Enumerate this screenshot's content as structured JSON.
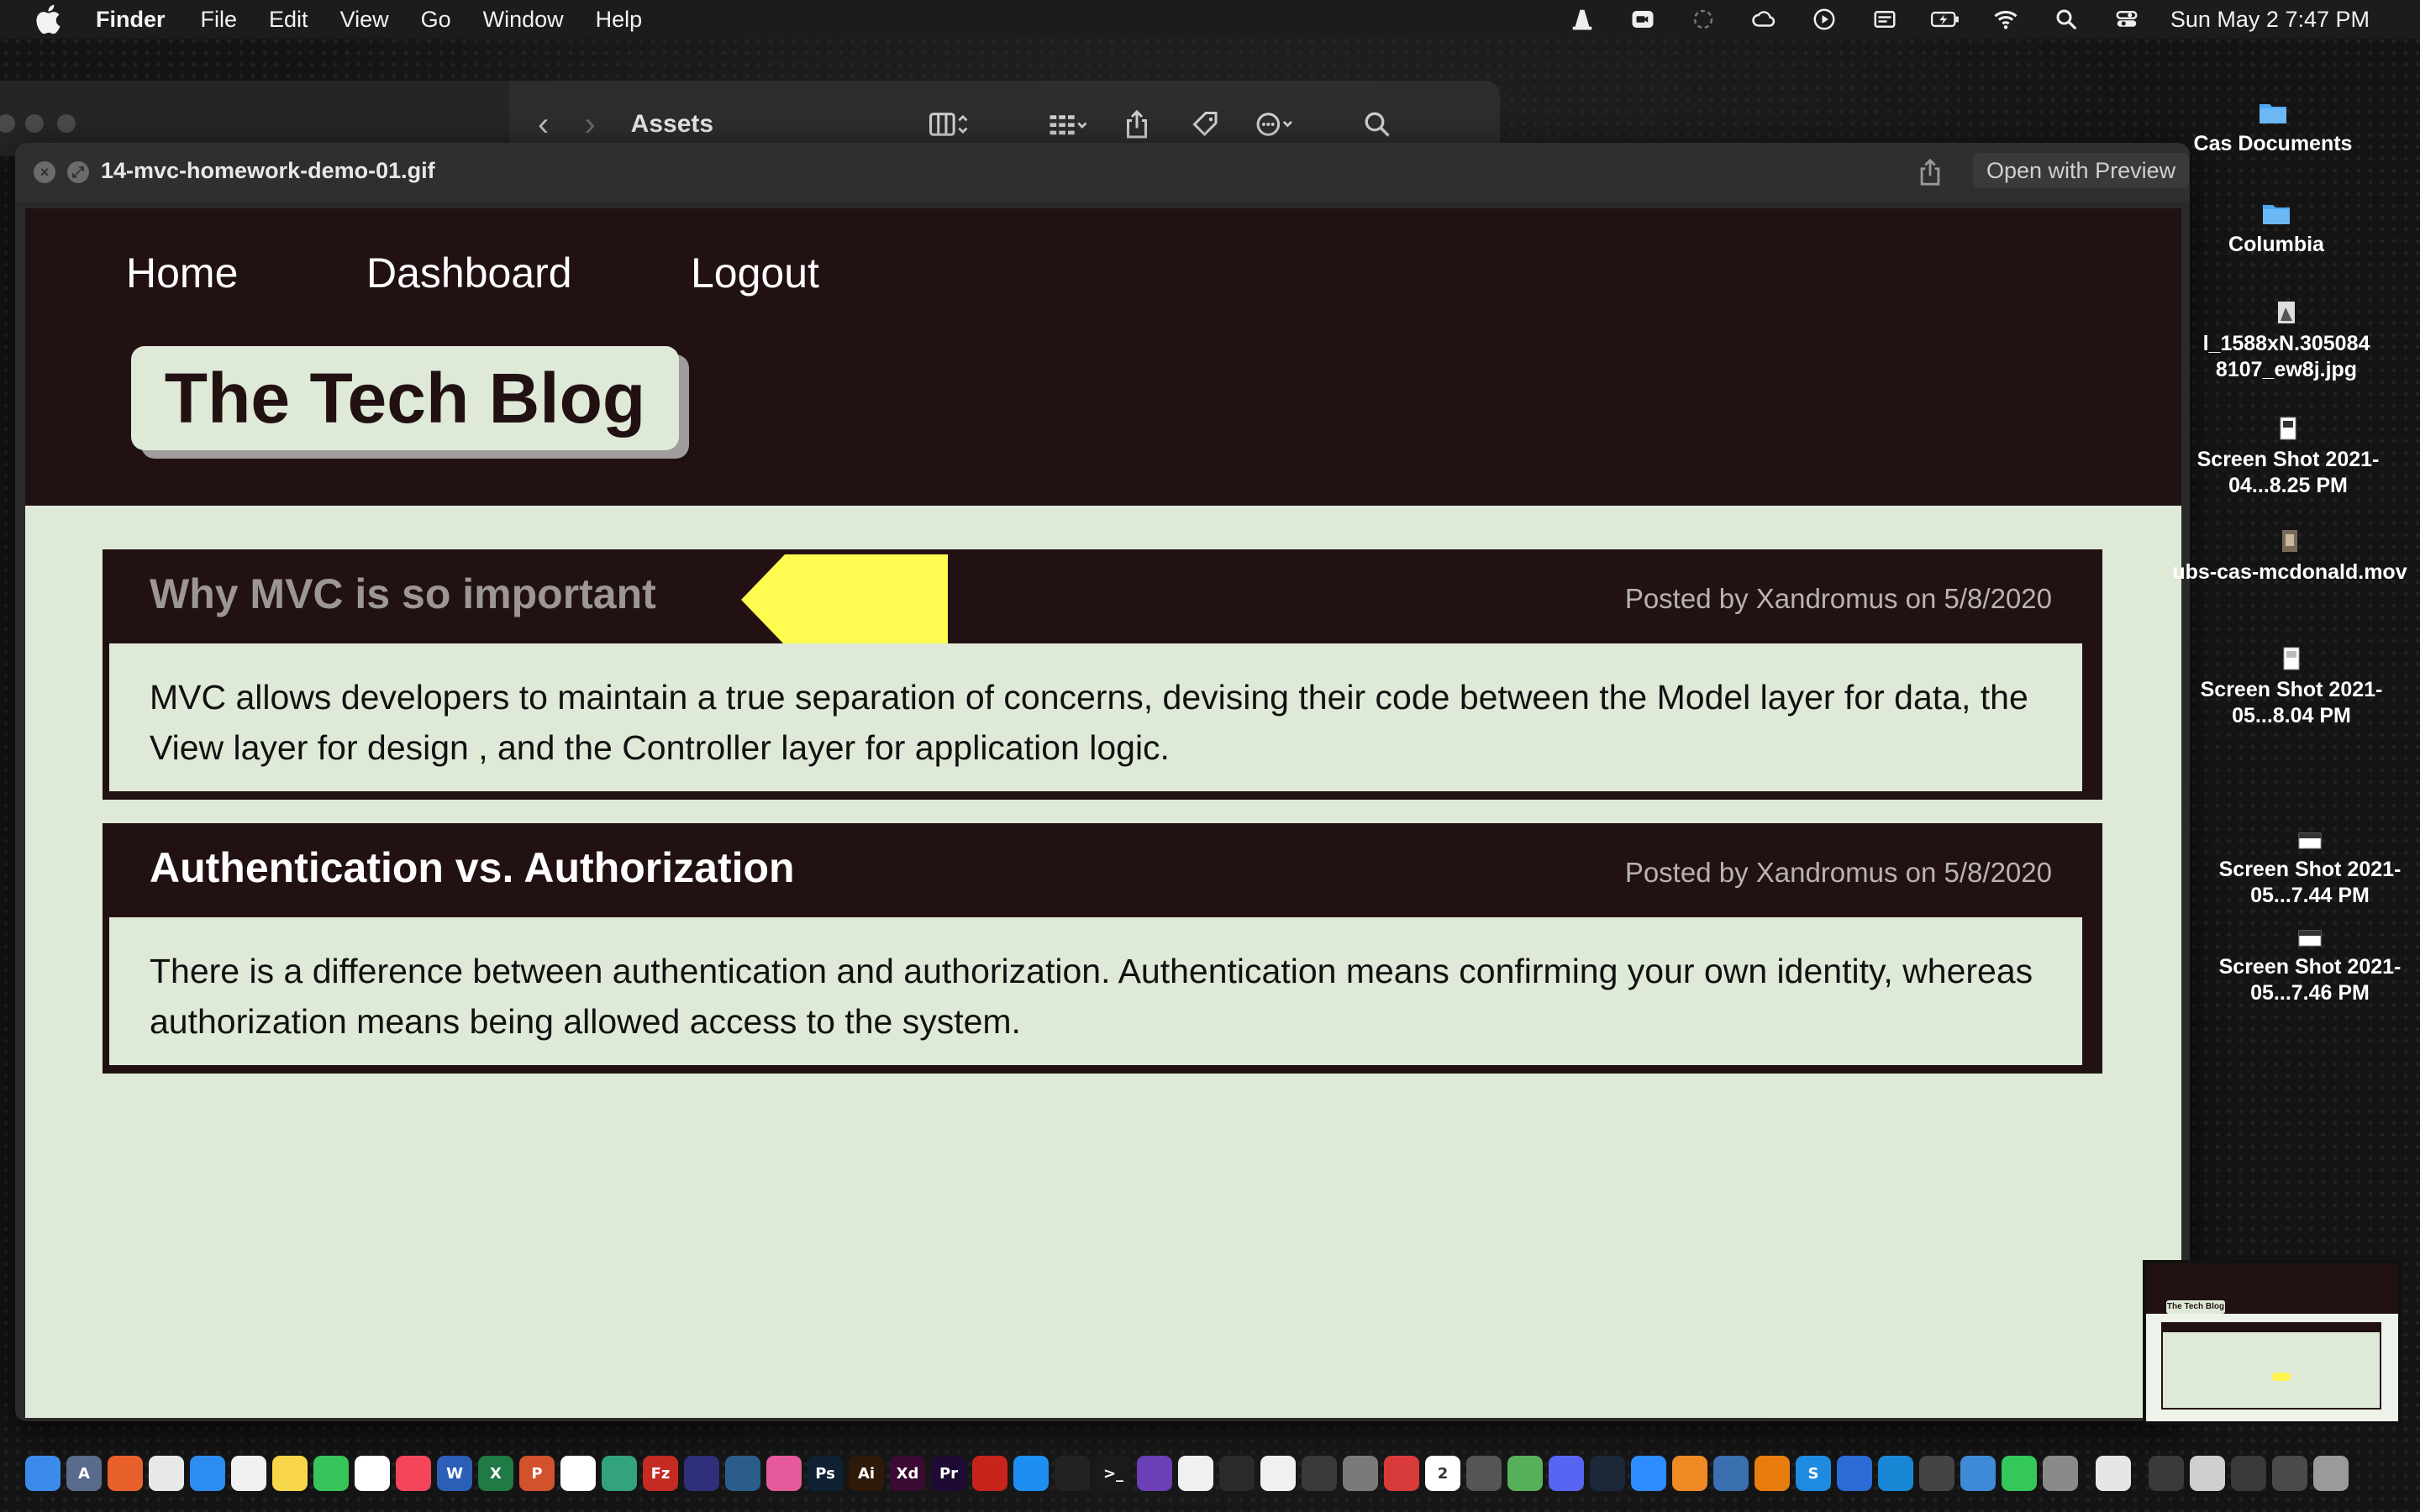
{
  "menubar": {
    "app_name": "Finder",
    "items": [
      "File",
      "Edit",
      "View",
      "Go",
      "Window",
      "Help"
    ],
    "status_icons": [
      "vlc-cone-icon",
      "zoom-video-icon",
      "creative-cloud-sync-icon",
      "creative-cloud-icon",
      "play-circle-icon",
      "keyboard-input-icon",
      "battery-charging-icon",
      "wifi-icon",
      "spotlight-search-icon",
      "control-center-icon"
    ],
    "datetime": "Sun May 2  7:47 PM"
  },
  "finder": {
    "title": "Assets",
    "back_icon": "chevron-left-icon",
    "forward_icon": "chevron-right-icon"
  },
  "quicklook": {
    "filename": "14-mvc-homework-demo-01.gif",
    "open_with": "Open with Preview"
  },
  "blog": {
    "nav": [
      "Home",
      "Dashboard",
      "Logout"
    ],
    "brand": "The Tech Blog",
    "posts": [
      {
        "title": "Why MVC is so important",
        "meta": "Posted by Xandromus on 5/8/2020",
        "body": "MVC allows developers to maintain a true separation of concerns, devising their code between the Model layer for data, the View layer for design , and the Controller layer for application logic."
      },
      {
        "title": "Authentication vs. Authorization",
        "meta": "Posted by Xandromus on 5/8/2020",
        "body": "There is a difference between authentication and authorization. Authentication means confirming your own identity, whereas authorization means being allowed access to the system."
      }
    ]
  },
  "desktop": {
    "items": [
      {
        "label": "Cas Documents",
        "icon": "folder-icon"
      },
      {
        "label": "Columbia",
        "icon": "folder-icon"
      },
      {
        "label": "l_1588xN.305084 8107_ew8j.jpg",
        "icon": "image-file-icon"
      },
      {
        "label": "Screen Shot 2021-04...8.25 PM",
        "icon": "screenshot-file-icon"
      },
      {
        "label": "ubs-cas-mcdonald.mov",
        "icon": "video-file-icon"
      },
      {
        "label": "Screen Shot 2021-05...8.04 PM",
        "icon": "screenshot-file-icon"
      },
      {
        "label": "Screen Shot 2021-05...7.44 PM",
        "icon": "screenshot-file-icon"
      },
      {
        "label": "Screen Shot 2021-05...7.46 PM",
        "icon": "screenshot-file-icon"
      }
    ],
    "thumbnail_brand": "The Tech Blog"
  },
  "dock": {
    "apps": [
      {
        "name": "finder",
        "color": "#3b8beb",
        "glyph": ""
      },
      {
        "name": "launchpad",
        "color": "#5a6b8c",
        "glyph": "A"
      },
      {
        "name": "firefox",
        "color": "#e8612c",
        "glyph": ""
      },
      {
        "name": "chrome",
        "color": "#e8e8e8",
        "glyph": ""
      },
      {
        "name": "safari",
        "color": "#2d8cf0",
        "glyph": ""
      },
      {
        "name": "news",
        "color": "#f0f0f0",
        "glyph": ""
      },
      {
        "name": "notes",
        "color": "#f7d64a",
        "glyph": ""
      },
      {
        "name": "messages",
        "color": "#37c45a",
        "glyph": ""
      },
      {
        "name": "slack",
        "color": "#ffffff",
        "glyph": ""
      },
      {
        "name": "music",
        "color": "#f4465a",
        "glyph": ""
      },
      {
        "name": "word",
        "color": "#2b5fb8",
        "glyph": "W"
      },
      {
        "name": "excel",
        "color": "#1f7a45",
        "glyph": "X"
      },
      {
        "name": "powerpoint",
        "color": "#d2522b",
        "glyph": "P"
      },
      {
        "name": "tableau",
        "color": "#ffffff",
        "glyph": ""
      },
      {
        "name": "chatgpt",
        "color": "#33a37f",
        "glyph": ""
      },
      {
        "name": "filezilla",
        "color": "#c52b22",
        "glyph": "Fz"
      },
      {
        "name": "marble",
        "color": "#2f2f7a",
        "glyph": ""
      },
      {
        "name": "mysql-workbench",
        "color": "#2b5d8a",
        "glyph": ""
      },
      {
        "name": "arc",
        "color": "#e65a9b",
        "glyph": ""
      },
      {
        "name": "photoshop",
        "color": "#0f2133",
        "glyph": "Ps"
      },
      {
        "name": "illustrator",
        "color": "#2f1a0a",
        "glyph": "Ai"
      },
      {
        "name": "xd",
        "color": "#3a0a33",
        "glyph": "Xd"
      },
      {
        "name": "premiere",
        "color": "#1f0a33",
        "glyph": "Pr"
      },
      {
        "name": "acrobat",
        "color": "#c7241c",
        "glyph": ""
      },
      {
        "name": "app-store",
        "color": "#1d8ff2",
        "glyph": ""
      },
      {
        "name": "activity-monitor",
        "color": "#222222",
        "glyph": ""
      },
      {
        "name": "terminal",
        "color": "#1a1a1a",
        "glyph": ">_"
      },
      {
        "name": "visual-studio",
        "color": "#6b3fb5",
        "glyph": ""
      },
      {
        "name": "photos",
        "color": "#f0f0f0",
        "glyph": ""
      },
      {
        "name": "figma",
        "color": "#2a2a2a",
        "glyph": ""
      },
      {
        "name": "unity",
        "color": "#f0f0f0",
        "glyph": ""
      },
      {
        "name": "chess",
        "color": "#3a3a3a",
        "glyph": ""
      },
      {
        "name": "system-preferences",
        "color": "#7a7a7a",
        "glyph": ""
      },
      {
        "name": "toolbox",
        "color": "#d93b3b",
        "glyph": ""
      },
      {
        "name": "calendar",
        "color": "#ffffff",
        "glyph": "2"
      },
      {
        "name": "calculator",
        "color": "#555555",
        "glyph": ""
      },
      {
        "name": "maps",
        "color": "#57b05a",
        "glyph": ""
      },
      {
        "name": "discord",
        "color": "#5865f2",
        "glyph": ""
      },
      {
        "name": "steam",
        "color": "#1b2838",
        "glyph": ""
      },
      {
        "name": "zoom",
        "color": "#2d8cff",
        "glyph": ""
      },
      {
        "name": "vlc",
        "color": "#f08a24",
        "glyph": ""
      },
      {
        "name": "quicktime",
        "color": "#3a6fb0",
        "glyph": ""
      },
      {
        "name": "blender",
        "color": "#e87d0d",
        "glyph": ""
      },
      {
        "name": "skype",
        "color": "#1f8be0",
        "glyph": "S"
      },
      {
        "name": "cc-cleaner",
        "color": "#2a6bd6",
        "glyph": ""
      },
      {
        "name": "edge",
        "color": "#1a87d6",
        "glyph": ""
      },
      {
        "name": "video-recorder",
        "color": "#444444",
        "glyph": ""
      },
      {
        "name": "desktop-folder",
        "color": "#3f8ad8",
        "glyph": ""
      },
      {
        "name": "facetime",
        "color": "#34c759",
        "glyph": ""
      },
      {
        "name": "preview",
        "color": "#8a8a8a",
        "glyph": ""
      },
      {
        "name": "textedit",
        "color": "#e6e6e6",
        "glyph": ""
      },
      {
        "name": "recent-window-1",
        "color": "#3a3a3a",
        "glyph": ""
      },
      {
        "name": "recent-window-2",
        "color": "#cfcfcf",
        "glyph": ""
      },
      {
        "name": "recent-window-3",
        "color": "#3a3a3a",
        "glyph": ""
      },
      {
        "name": "recent-window-4",
        "color": "#4a4a4a",
        "glyph": ""
      },
      {
        "name": "trash",
        "color": "#9a9a9a",
        "glyph": ""
      }
    ]
  }
}
